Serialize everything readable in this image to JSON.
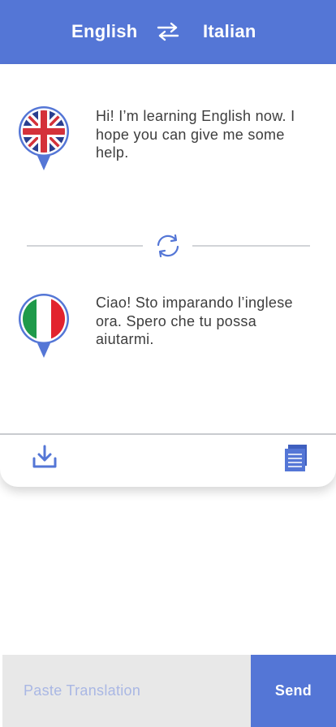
{
  "header": {
    "source_language": "English",
    "target_language": "Italian",
    "swap_icon": "swap-arrows-icon"
  },
  "conversation": {
    "source": {
      "flag_icon": "uk-flag-icon",
      "text": "Hi! I’m learning English now. I hope you can give me some help."
    },
    "target": {
      "flag_icon": "italy-flag-icon",
      "text": "Ciao! Sto imparando l’inglese ora. Spero che tu possa aiutarmi."
    },
    "refresh_icon": "refresh-icon"
  },
  "toolbar": {
    "download_icon": "download-icon",
    "document_icon": "document-icon"
  },
  "footer": {
    "paste_placeholder": "Paste Translation",
    "send_label": "Send"
  },
  "colors": {
    "accent": "#5476d6",
    "input_background": "#e8e8e8",
    "placeholder": "#a9b7e4",
    "text": "#3d3d3d"
  }
}
